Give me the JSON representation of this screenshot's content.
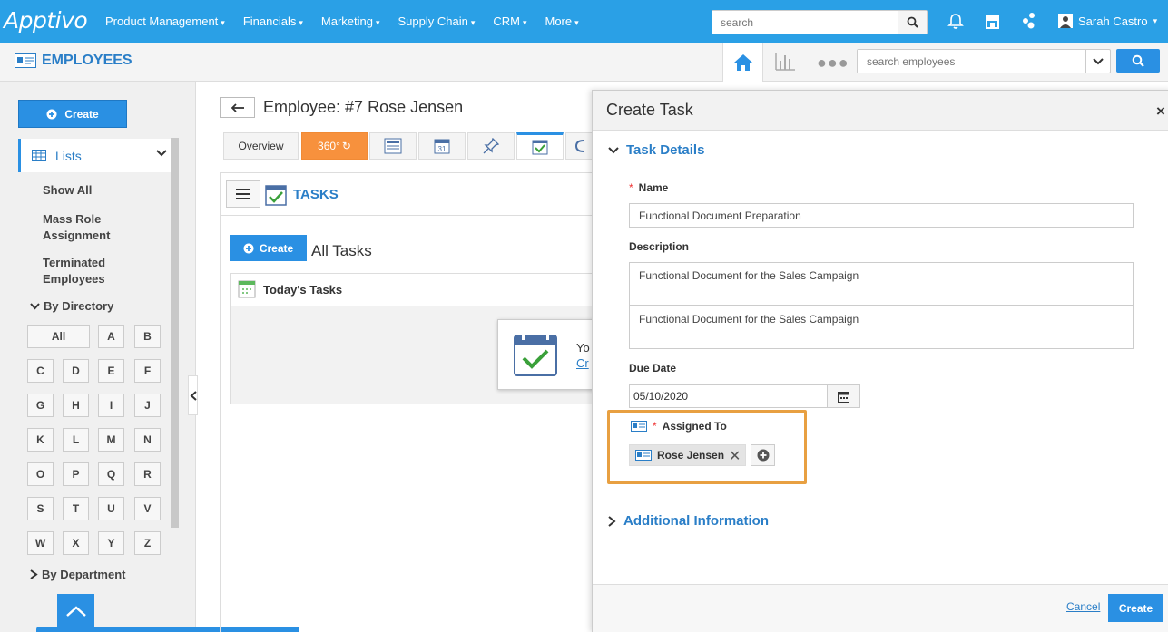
{
  "brand": {
    "logo": "Apptivo"
  },
  "topnav": {
    "items": [
      {
        "label": "Product Management",
        "caret": "▾"
      },
      {
        "label": "Financials",
        "caret": "▾"
      },
      {
        "label": "Marketing",
        "caret": "▾"
      },
      {
        "label": "Supply Chain",
        "caret": "▾"
      },
      {
        "label": "CRM",
        "caret": "▾"
      },
      {
        "label": "More",
        "caret": "▾"
      }
    ],
    "search_placeholder": "search",
    "user": "Sarah Castro",
    "user_caret": "▾"
  },
  "module": {
    "title": "EMPLOYEES",
    "search_placeholder": "search employees"
  },
  "sidebar": {
    "create_label": "Create",
    "lists_label": "Lists",
    "links": [
      "Show All",
      "Mass Role Assignment",
      "Terminated Employees"
    ],
    "by_directory": "By Directory",
    "letters": [
      "All",
      "A",
      "B",
      "C",
      "D",
      "E",
      "F",
      "G",
      "H",
      "I",
      "J",
      "K",
      "L",
      "M",
      "N",
      "O",
      "P",
      "Q",
      "R",
      "S",
      "T",
      "U",
      "V",
      "W",
      "X",
      "Y",
      "Z"
    ],
    "by_department": "By Department"
  },
  "main": {
    "employee_title": "Employee: #7 Rose Jensen",
    "tabs": {
      "overview": "Overview",
      "tab360": "360°"
    },
    "tasks_title": "TASKS",
    "create_label": "Create",
    "all_tasks": "All Tasks",
    "todays_tasks": "Today's Tasks",
    "popover_text": "Yo",
    "popover_link": "Cr"
  },
  "create_task": {
    "title": "Create Task",
    "close": "×",
    "section_task_details": "Task Details",
    "name_label": "Name",
    "name_value": "Functional Document Preparation",
    "description_label": "Description",
    "description_1": "Functional Document for the Sales Campaign",
    "description_2": "Functional Document for the Sales Campaign",
    "due_date_label": "Due Date",
    "due_date_value": "05/10/2020",
    "assigned_to_label": "Assigned To",
    "assignee": "Rose Jensen",
    "remove": "✕",
    "section_additional": "Additional Information",
    "cancel_label": "Cancel",
    "create_label": "Create"
  },
  "colors": {
    "brand_blue": "#2aa0e6",
    "button_blue": "#2a90e3",
    "highlight_orange": "#e8a041",
    "tab_orange": "#f7913d"
  }
}
